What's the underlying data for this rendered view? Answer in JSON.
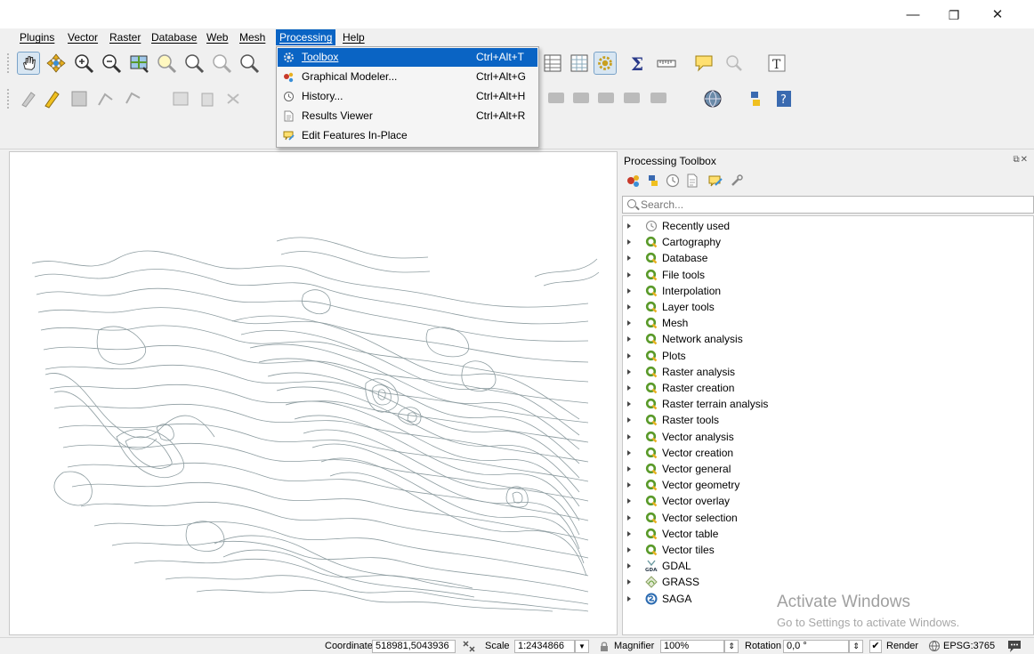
{
  "window": {
    "minimize": "—",
    "restore": "❐",
    "close": "✕"
  },
  "menubar": {
    "items": [
      {
        "label": "Plugins"
      },
      {
        "label": "Vector"
      },
      {
        "label": "Raster"
      },
      {
        "label": "Database"
      },
      {
        "label": "Web"
      },
      {
        "label": "Mesh"
      },
      {
        "label": "Processing"
      },
      {
        "label": "Help"
      }
    ]
  },
  "processing_menu": {
    "items": [
      {
        "label": "Toolbox",
        "shortcut": "Ctrl+Alt+T",
        "icon": "gear-icon"
      },
      {
        "label": "Graphical Modeler...",
        "shortcut": "Ctrl+Alt+G",
        "icon": "modeler-icon"
      },
      {
        "label": "History...",
        "shortcut": "Ctrl+Alt+H",
        "icon": "clock-icon"
      },
      {
        "label": "Results Viewer",
        "shortcut": "Ctrl+Alt+R",
        "icon": "document-icon"
      },
      {
        "label": "Edit Features In-Place",
        "shortcut": "",
        "icon": "edit-in-place-icon"
      }
    ]
  },
  "toolbox_panel": {
    "title": "Processing Toolbox",
    "search_placeholder": "Search...",
    "items": [
      {
        "label": "Recently used",
        "icon": "clock-icon"
      },
      {
        "label": "Cartography",
        "icon": "qgis-icon"
      },
      {
        "label": "Database",
        "icon": "qgis-icon"
      },
      {
        "label": "File tools",
        "icon": "qgis-icon"
      },
      {
        "label": "Interpolation",
        "icon": "qgis-icon"
      },
      {
        "label": "Layer tools",
        "icon": "qgis-icon"
      },
      {
        "label": "Mesh",
        "icon": "qgis-icon"
      },
      {
        "label": "Network analysis",
        "icon": "qgis-icon"
      },
      {
        "label": "Plots",
        "icon": "qgis-icon"
      },
      {
        "label": "Raster analysis",
        "icon": "qgis-icon"
      },
      {
        "label": "Raster creation",
        "icon": "qgis-icon"
      },
      {
        "label": "Raster terrain analysis",
        "icon": "qgis-icon"
      },
      {
        "label": "Raster tools",
        "icon": "qgis-icon"
      },
      {
        "label": "Vector analysis",
        "icon": "qgis-icon"
      },
      {
        "label": "Vector creation",
        "icon": "qgis-icon"
      },
      {
        "label": "Vector general",
        "icon": "qgis-icon"
      },
      {
        "label": "Vector geometry",
        "icon": "qgis-icon"
      },
      {
        "label": "Vector overlay",
        "icon": "qgis-icon"
      },
      {
        "label": "Vector selection",
        "icon": "qgis-icon"
      },
      {
        "label": "Vector table",
        "icon": "qgis-icon"
      },
      {
        "label": "Vector tiles",
        "icon": "qgis-icon"
      },
      {
        "label": "GDAL",
        "icon": "gdal-icon"
      },
      {
        "label": "GRASS",
        "icon": "grass-icon"
      },
      {
        "label": "SAGA",
        "icon": "saga-icon"
      }
    ]
  },
  "watermark": {
    "line1": "Activate Windows",
    "line2": "Go to Settings to activate Windows."
  },
  "statusbar": {
    "coordinate_label": "Coordinate",
    "coordinate_value": "518981,5043936",
    "scale_label": "Scale",
    "scale_value": "1:2434866",
    "magnifier_label": "Magnifier",
    "magnifier_value": "100%",
    "rotation_label": "Rotation",
    "rotation_value": "0,0 °",
    "render_label": "Render",
    "crs_label": "EPSG:3765"
  },
  "colors": {
    "highlight": "#0a64c4",
    "qgis_green": "#5a9a2a",
    "contour": "#8d9ca0"
  }
}
